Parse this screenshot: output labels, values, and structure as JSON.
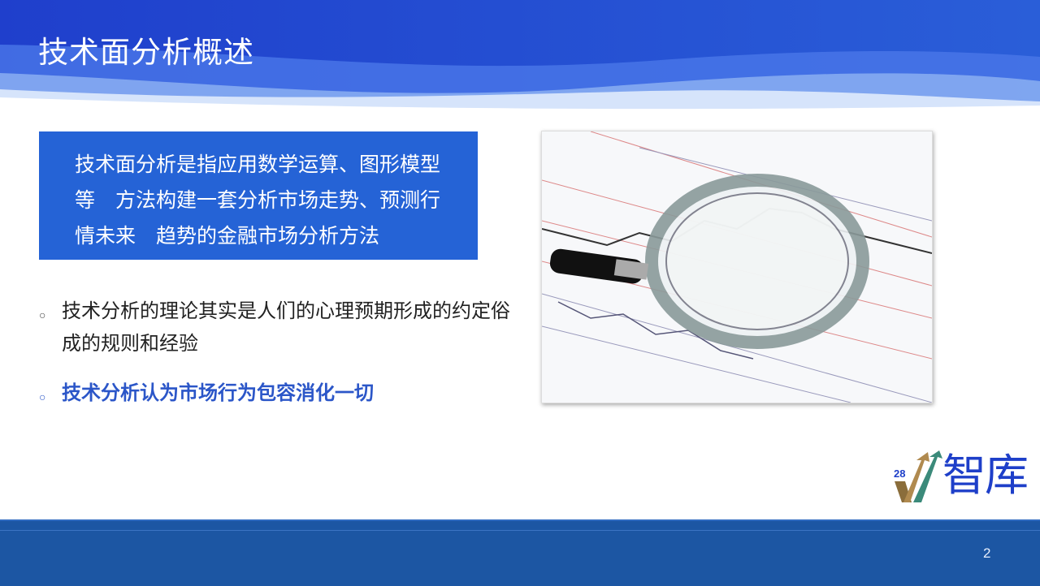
{
  "slide": {
    "title": "技术面分析概述",
    "definition": "技术面分析是指应用数学运算、图形模型等　方法构建一套分析市场走势、预测行情未来　趋势的金融市场分析方法",
    "bullets": [
      {
        "text": "技术分析的理论其实是人们的心理预期形成的约定俗成的规则和经验",
        "icon": "circle-bullet-icon"
      },
      {
        "text": "技术分析认为市场行为包容消化一切",
        "icon": "circle-bullet-icon"
      }
    ],
    "logo": {
      "number": "28",
      "text": "智库"
    },
    "page_number": "2"
  },
  "colors": {
    "accent": "#2563d6",
    "header": "#1e44cc",
    "footer": "#1c56a3",
    "highlight": "#2b56c8"
  }
}
